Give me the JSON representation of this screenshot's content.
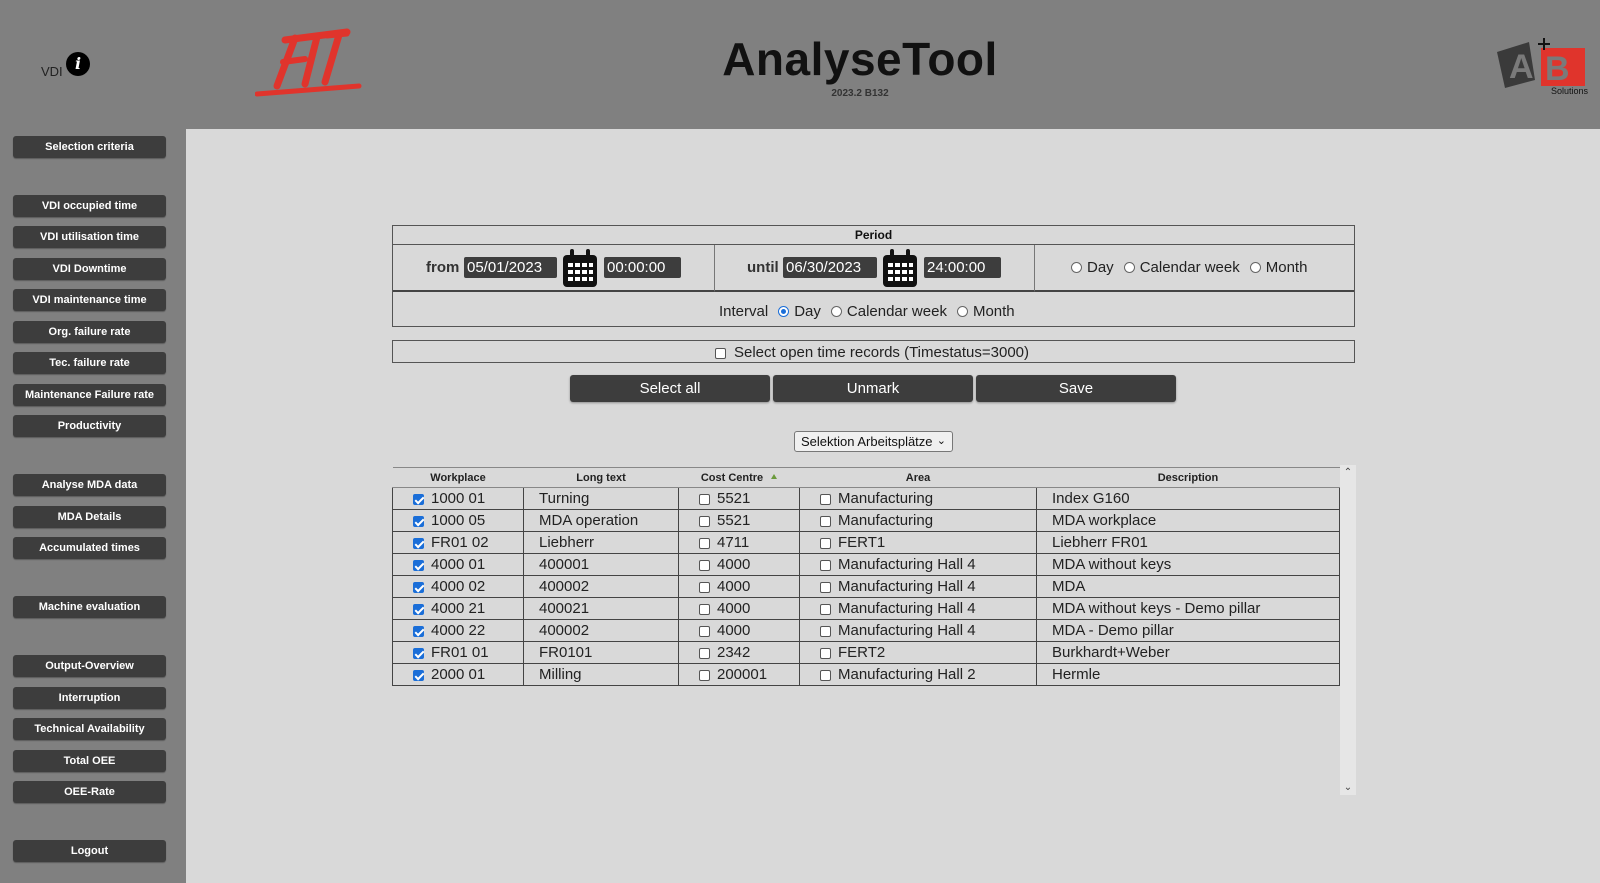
{
  "header": {
    "vdi_label": "VDI",
    "title": "AnalyseTool",
    "version": "2023.2 B132",
    "brand_logo_text": "Solutions"
  },
  "sidebar": {
    "items": [
      {
        "label": "Selection criteria"
      },
      {
        "label": "VDI occupied time"
      },
      {
        "label": "VDI utilisation time"
      },
      {
        "label": "VDI Downtime"
      },
      {
        "label": "VDI maintenance time"
      },
      {
        "label": "Org. failure rate"
      },
      {
        "label": "Tec. failure rate"
      },
      {
        "label": "Maintenance Failure rate"
      },
      {
        "label": "Productivity"
      },
      {
        "label": "Analyse MDA data"
      },
      {
        "label": "MDA Details"
      },
      {
        "label": "Accumulated times"
      },
      {
        "label": "Machine evaluation"
      },
      {
        "label": "Output-Overview"
      },
      {
        "label": "Interruption"
      },
      {
        "label": "Technical Availability"
      },
      {
        "label": "Total OEE"
      },
      {
        "label": "OEE-Rate"
      },
      {
        "label": "Logout"
      }
    ]
  },
  "period": {
    "title": "Period",
    "from_label": "from",
    "from_date": "05/01/2023",
    "from_time": "00:00:00",
    "until_label": "until",
    "until_date": "06/30/2023",
    "until_time": "24:00:00",
    "range_options": [
      "Day",
      "Calendar week",
      "Month"
    ],
    "interval_label": "Interval",
    "interval_options": [
      "Day",
      "Calendar week",
      "Month"
    ],
    "interval_selected": "Day"
  },
  "open_records": {
    "label": "Select open time records (Timestatus=3000)",
    "checked": false
  },
  "actions": {
    "select_all": "Select all",
    "unmark": "Unmark",
    "save": "Save"
  },
  "workplace_select": {
    "value": "Selektion Arbeitsplätze"
  },
  "table": {
    "headers": [
      "Workplace",
      "Long text",
      "Cost Centre",
      "Area",
      "Description"
    ],
    "rows": [
      {
        "workplace": "1000 01",
        "long_text": "Turning",
        "cost_centre": "5521",
        "area": "Manufacturing",
        "description": "Index G160"
      },
      {
        "workplace": "1000 05",
        "long_text": "MDA operation",
        "cost_centre": "5521",
        "area": "Manufacturing",
        "description": "MDA workplace"
      },
      {
        "workplace": "FR01 02",
        "long_text": "Liebherr",
        "cost_centre": "4711",
        "area": "FERT1",
        "description": "Liebherr FR01"
      },
      {
        "workplace": "4000 01",
        "long_text": "400001",
        "cost_centre": "4000",
        "area": "Manufacturing Hall 4",
        "description": "MDA without keys"
      },
      {
        "workplace": "4000 02",
        "long_text": "400002",
        "cost_centre": "4000",
        "area": "Manufacturing Hall 4",
        "description": "MDA"
      },
      {
        "workplace": "4000 21",
        "long_text": "400021",
        "cost_centre": "4000",
        "area": "Manufacturing Hall 4",
        "description": "MDA without keys - Demo pillar"
      },
      {
        "workplace": "4000 22",
        "long_text": "400002",
        "cost_centre": "4000",
        "area": "Manufacturing Hall 4",
        "description": "MDA - Demo pillar"
      },
      {
        "workplace": "FR01 01",
        "long_text": "FR0101",
        "cost_centre": "2342",
        "area": "FERT2",
        "description": "Burkhardt+Weber"
      },
      {
        "workplace": "2000 01",
        "long_text": "Milling",
        "cost_centre": "200001",
        "area": "Manufacturing Hall 2",
        "description": "Hermle"
      }
    ]
  },
  "colors": {
    "header_bg": "#808080",
    "content_bg": "#d9d9d9",
    "button_bg": "#3d3d3d",
    "accent_red": "#e0342c",
    "check_blue": "#1a6ed8"
  }
}
